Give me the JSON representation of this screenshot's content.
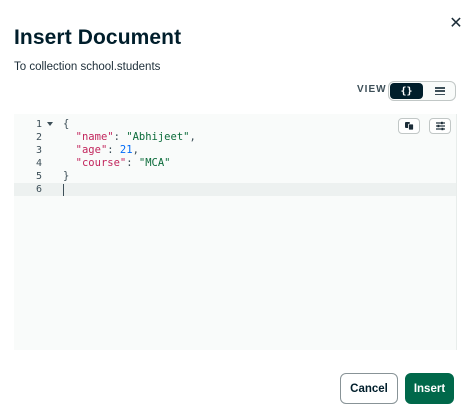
{
  "modal": {
    "title": "Insert Document",
    "subtitle": "To collection school.students",
    "close_icon": "close-icon"
  },
  "view": {
    "label": "VIEW",
    "json_option": "{}",
    "list_icon": "list-icon",
    "selected": "json"
  },
  "editor": {
    "line_numbers": [
      "1",
      "2",
      "3",
      "4",
      "5",
      "6"
    ],
    "lines": [
      {
        "open": "{"
      },
      {
        "key": "\"name\"",
        "sep": ": ",
        "value": "\"Abhijeet\"",
        "trail": ","
      },
      {
        "key": "\"age\"",
        "sep": ": ",
        "value": "21",
        "trail": ","
      },
      {
        "key": "\"course\"",
        "sep": ": ",
        "value": "\"MCA\"",
        "trail": ""
      },
      {
        "close": "}"
      },
      {
        "empty": ""
      }
    ],
    "copy_icon": "copy-icon",
    "format_icon": "settings-sliders-icon"
  },
  "footer": {
    "cancel_label": "Cancel",
    "insert_label": "Insert"
  },
  "colors": {
    "primary_button": "#00684a",
    "toggle_selected": "#001e2b",
    "string_value": "#0b6b3a",
    "key": "#c2255c",
    "number": "#016bf8"
  }
}
